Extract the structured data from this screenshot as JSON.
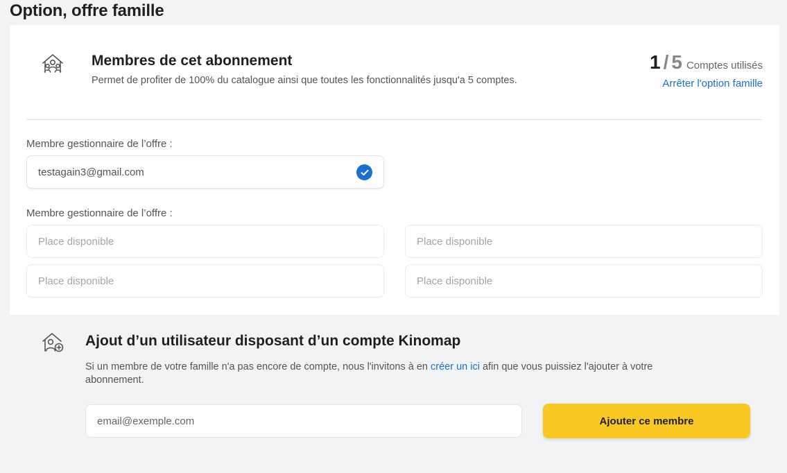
{
  "page": {
    "title": "Option, offre famille"
  },
  "members": {
    "icon": "family-house-icon",
    "title": "Membres de cet abonnement",
    "description": "Permet de profiter de 100% du catalogue ainsi que toutes les fonctionnalités jusqu'a 5 comptes.",
    "count_used": "1",
    "count_separator": "/",
    "count_total": "5",
    "count_label": "Comptes utilisés",
    "stop_link": "Arrêter l'option famille"
  },
  "manager": {
    "label": "Membre gestionnaire de l’offre :",
    "email": "testagain3@gmail.com",
    "status_icon": "check-circle-icon"
  },
  "slots": {
    "label": "Membre gestionnaire de l’offre :",
    "items": [
      "Place disponible",
      "Place disponible",
      "Place disponible",
      "Place disponible"
    ]
  },
  "add_user": {
    "icon": "add-user-house-icon",
    "title": "Ajout d’un utilisateur disposant d’un compte Kinomap",
    "desc_before": "Si un membre de votre famille n'a pas encore de compte, nous l'invitons à en ",
    "desc_link": "créer un ici",
    "desc_after": " afin que vous puissiez l'ajouter à votre abonnement.",
    "email_placeholder": "email@exemple.com",
    "button_label": "Ajouter ce membre"
  },
  "colors": {
    "accent": "#1a6fd1",
    "button": "#f9c823",
    "section_bg": "#f2f3f5"
  }
}
